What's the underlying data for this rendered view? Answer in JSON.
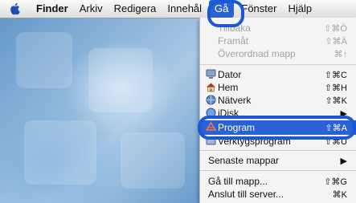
{
  "menubar": {
    "items": [
      "Finder",
      "Arkiv",
      "Redigera",
      "Innehål",
      "Gå",
      "Fönster",
      "Hjälp"
    ]
  },
  "go_menu": {
    "items": [
      {
        "label": "Tillbaka",
        "shortcut": "⇧⌘Ö",
        "state": "disabled"
      },
      {
        "label": "Framåt",
        "shortcut": "⇧⌘Ä",
        "state": "disabled"
      },
      {
        "label": "Överordnad mapp",
        "shortcut": "⌘↑",
        "state": "disabled"
      },
      {
        "label": "Dator",
        "shortcut": "⇧⌘C",
        "icon": "computer-icon"
      },
      {
        "label": "Hem",
        "shortcut": "⇧⌘H",
        "icon": "home-icon"
      },
      {
        "label": "Nätverk",
        "shortcut": "⇧⌘K",
        "icon": "network-icon"
      },
      {
        "label": "iDisk",
        "shortcut": "▶",
        "icon": "idisk-icon"
      },
      {
        "label": "Program",
        "shortcut": "⇧⌘A",
        "icon": "applications-icon",
        "state": "highlighted"
      },
      {
        "label": "Verktygsprogram",
        "shortcut": "⇧⌘U",
        "icon": "utilities-icon"
      },
      {
        "label": "Senaste mappar",
        "shortcut": "▶"
      },
      {
        "label": "Gå till mapp...",
        "shortcut": "⇧⌘G"
      },
      {
        "label": "Anslut till server...",
        "shortcut": "⌘K"
      }
    ]
  },
  "colors": {
    "highlight": "#2a62d6",
    "callout_ring": "#1c57d6"
  }
}
